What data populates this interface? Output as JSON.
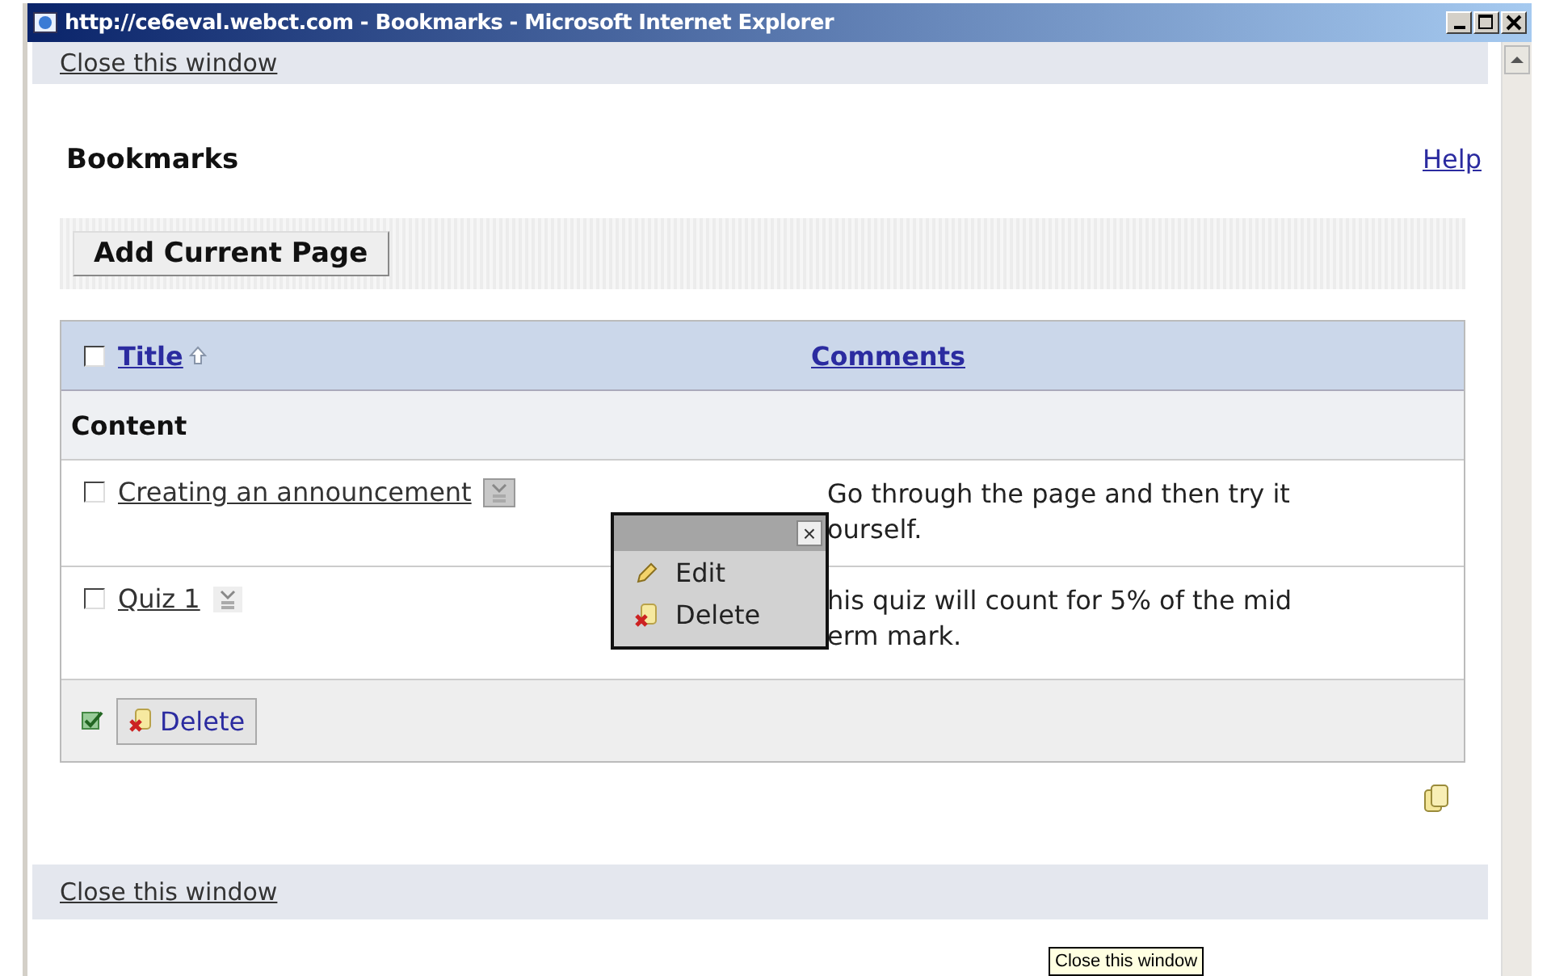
{
  "window": {
    "title": "http://ce6eval.webct.com - Bookmarks - Microsoft Internet Explorer"
  },
  "top_link": "Close this window",
  "heading": "Bookmarks",
  "help_link": "Help",
  "add_button": "Add Current Page",
  "table": {
    "select_all_checked": false,
    "columns": [
      {
        "label": "Title",
        "sorted": true
      },
      {
        "label": "Comments",
        "sorted": false
      }
    ],
    "group": "Content",
    "rows": [
      {
        "title": "Creating an announcement",
        "comment_lines": [
          "Go through the page and then try it",
          "ourself."
        ],
        "checked": false,
        "menu_open": true
      },
      {
        "title": "Quiz 1",
        "comment_lines": [
          "his quiz will count for 5% of the mid",
          "erm mark."
        ],
        "checked": false,
        "menu_open": false
      }
    ],
    "footer_button": "Delete"
  },
  "popup_menu": {
    "close": "×",
    "items": [
      {
        "kind": "edit",
        "label": "Edit"
      },
      {
        "kind": "delete",
        "label": "Delete"
      }
    ]
  },
  "bottom_link": "Close this window",
  "tooltip": "Close this window"
}
